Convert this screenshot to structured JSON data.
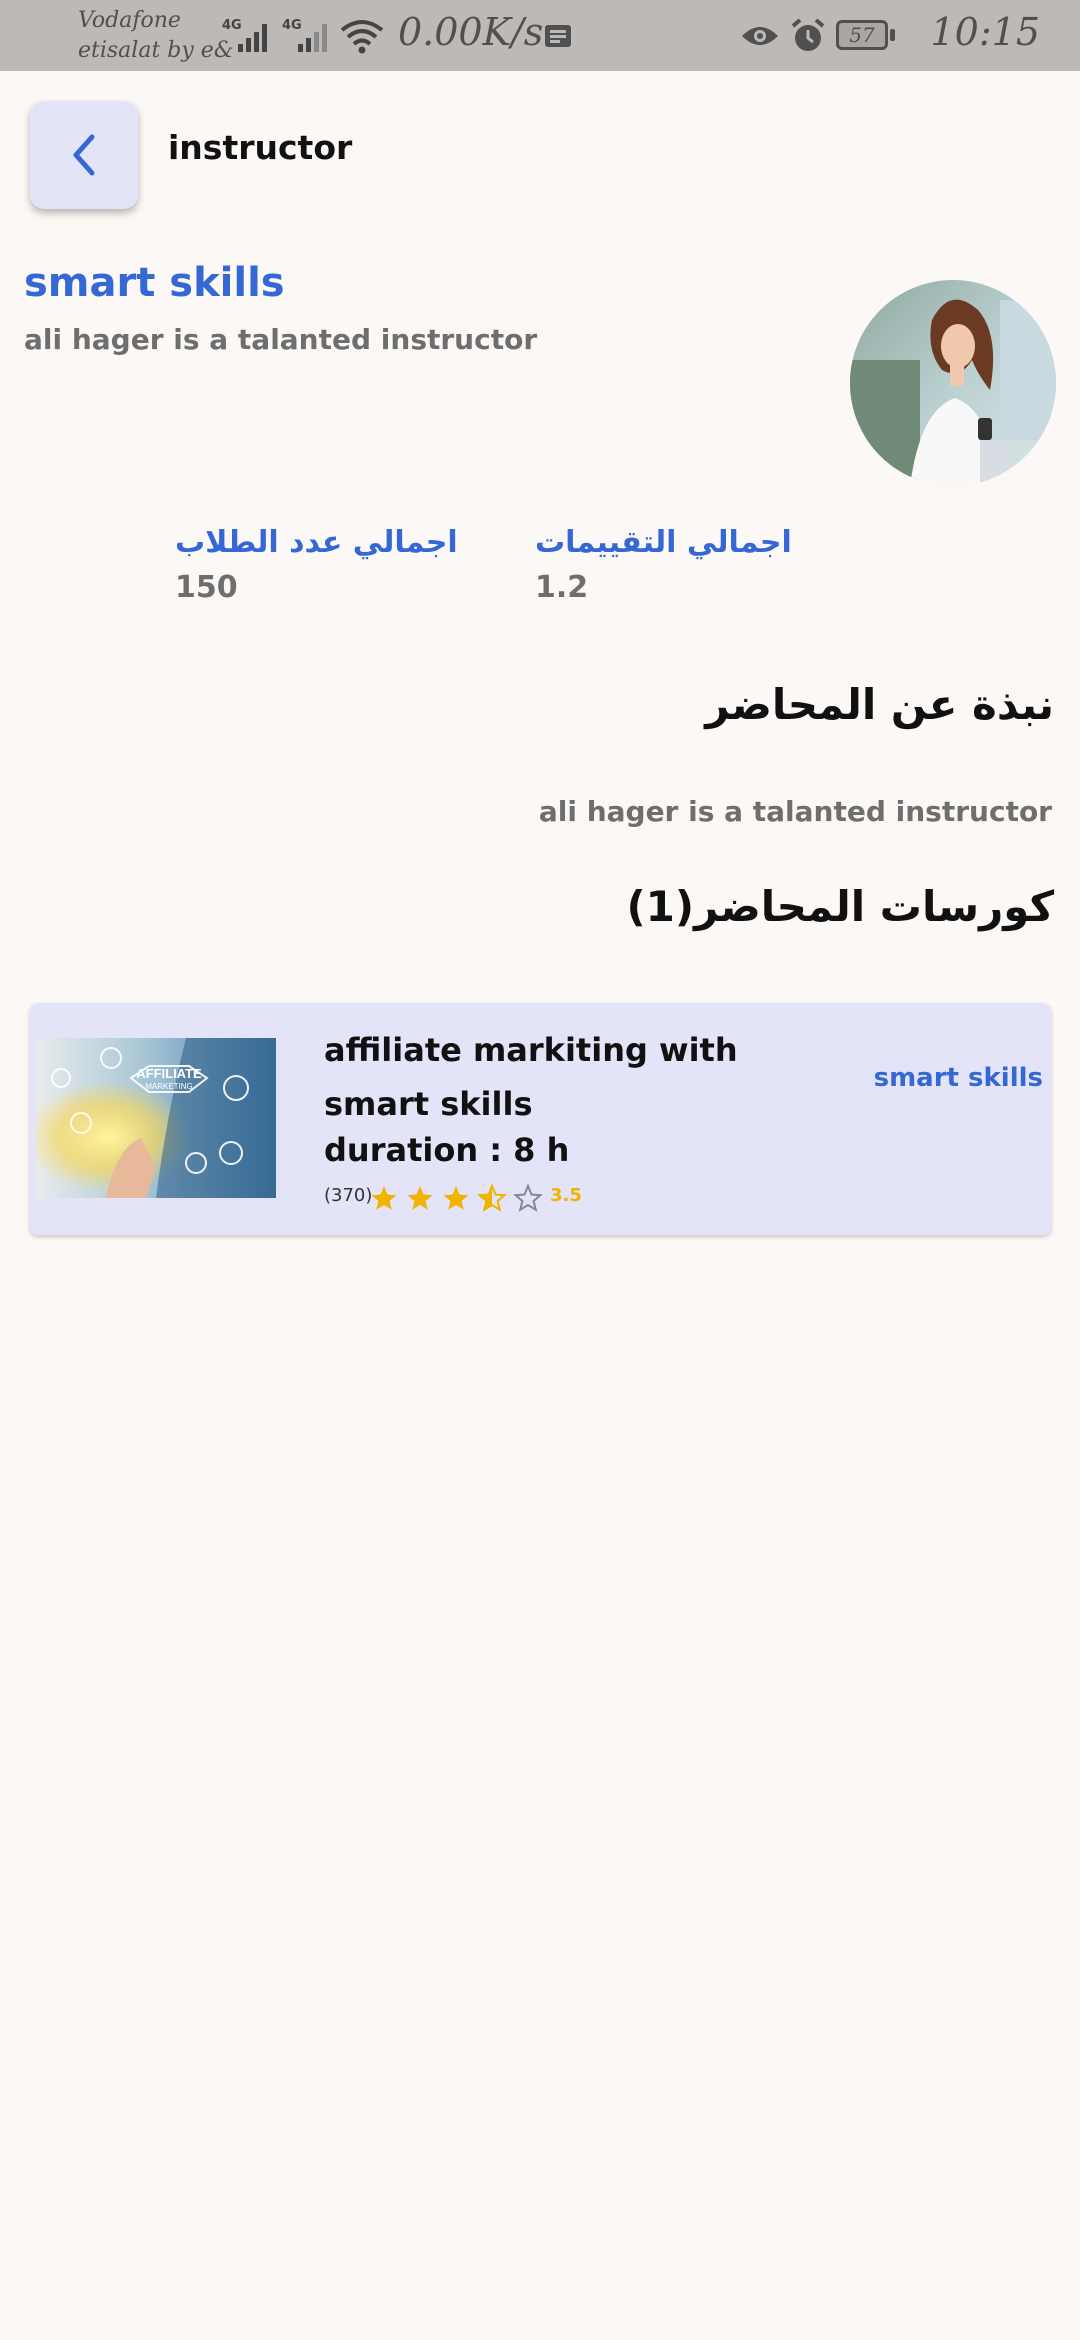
{
  "status_bar": {
    "carrier_line1": "Vodafone",
    "carrier_line2": "etisalat by e&",
    "network1": "4G",
    "network2": "4G",
    "net_speed": "0.00K/s",
    "battery": "57",
    "time": "10:15"
  },
  "header": {
    "title": "instructor"
  },
  "instructor": {
    "name": "smart skills",
    "subtitle": "ali hager is a talanted instructor"
  },
  "stats": {
    "ratings_label": "اجمالي التقييمات",
    "ratings_value": "1.2",
    "students_label": "اجمالي عدد الطلاب",
    "students_value": "150"
  },
  "about": {
    "heading": "نبذة عن المحاضر",
    "text": "ali hager is a talanted instructor"
  },
  "courses": {
    "heading": "كورسات المحاضر(1)",
    "items": [
      {
        "title": "affiliate markiting with smart skills",
        "duration": "duration : 8 h",
        "review_count": "(370)",
        "rating": "3.5",
        "rating_value": 3.5,
        "brand": "smart skills",
        "thumb_text_1": "AFFILIATE",
        "thumb_text_2": "MARKETING"
      }
    ]
  },
  "colors": {
    "accent": "#3568d4",
    "card_bg": "#e4e4f8",
    "star": "#f0b400",
    "page_bg": "#fcf8f5"
  }
}
